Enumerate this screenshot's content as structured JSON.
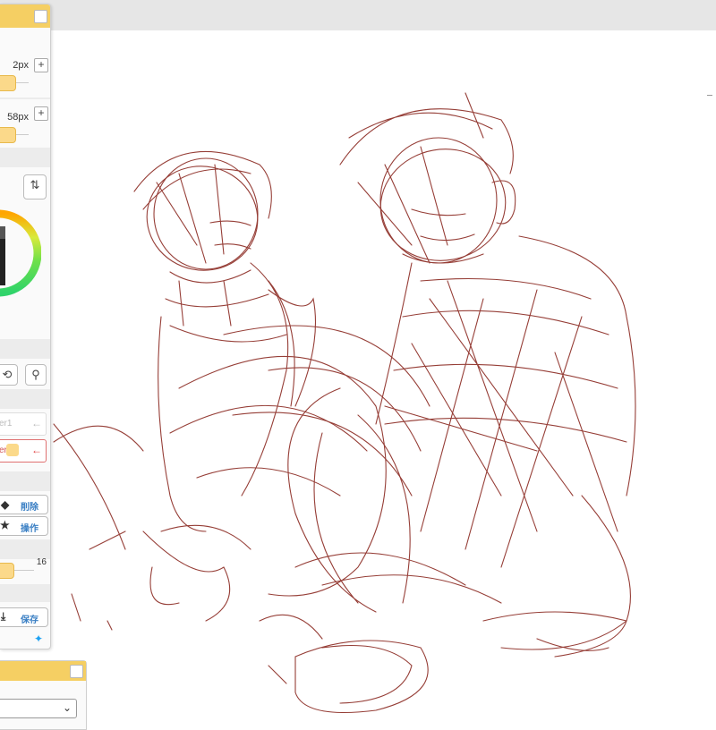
{
  "tool_panel": {
    "brush_size_value": "2px",
    "brush_size_plus": "+",
    "opacity_value": "58px",
    "opacity_plus": "+",
    "layer1_label": "er1",
    "layer2_label": "er2",
    "delete_label": "削除",
    "operation_label": "操作",
    "scale_value": "16",
    "save_label": "保存"
  },
  "colors": {
    "panel_header": "#f5cf63",
    "sketch_stroke": "#8b2a22",
    "accent_blue": "#3a7fc4",
    "active_layer": "#e07070"
  }
}
